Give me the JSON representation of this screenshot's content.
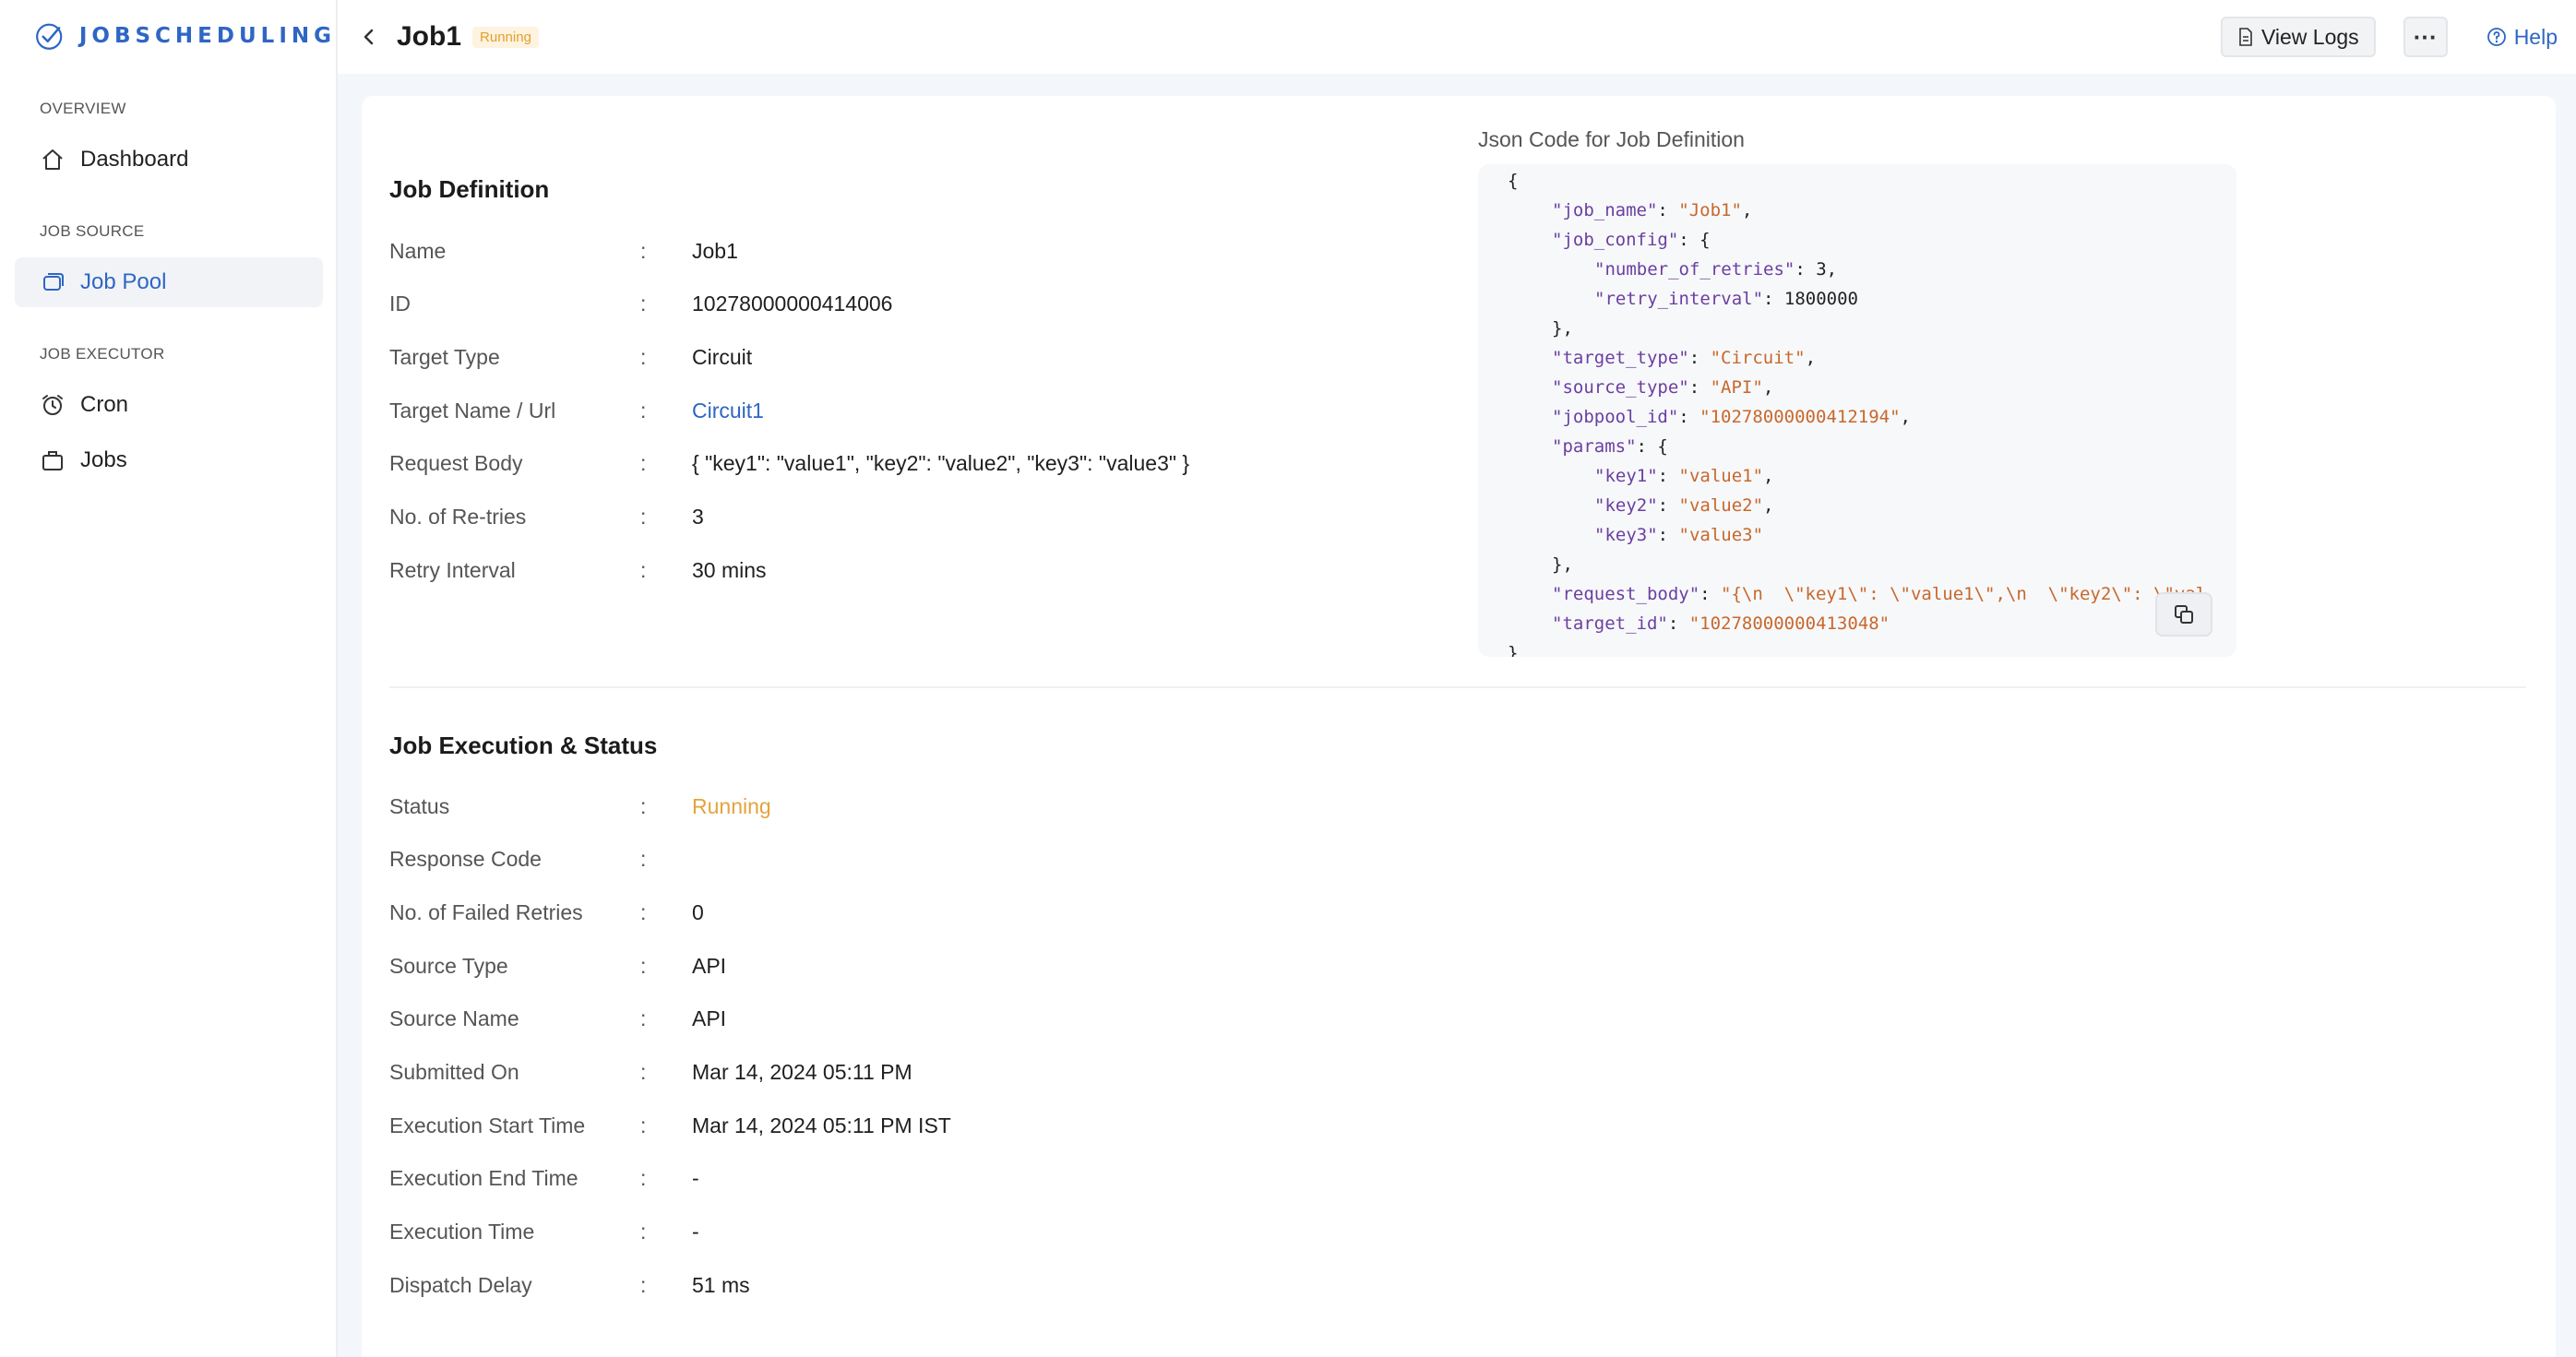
{
  "app": {
    "brand": "JOBSCHEDULING"
  },
  "sidebar": {
    "sections": [
      {
        "label": "OVERVIEW",
        "items": [
          {
            "label": "Dashboard",
            "icon": "home-icon"
          }
        ]
      },
      {
        "label": "JOB SOURCE",
        "items": [
          {
            "label": "Job Pool",
            "icon": "layers-icon",
            "active": true
          }
        ]
      },
      {
        "label": "JOB EXECUTOR",
        "items": [
          {
            "label": "Cron",
            "icon": "alarm-clock-icon"
          },
          {
            "label": "Jobs",
            "icon": "briefcase-icon"
          }
        ]
      }
    ]
  },
  "header": {
    "title": "Job1",
    "status": "Running",
    "view_logs_label": "View Logs",
    "more_label": "···",
    "help_label": "Help"
  },
  "definition": {
    "title": "Job Definition",
    "rows": [
      {
        "label": "Name",
        "value": "Job1"
      },
      {
        "label": "ID",
        "value": "10278000000414006"
      },
      {
        "label": "Target Type",
        "value": "Circuit"
      },
      {
        "label": "Target Name / Url",
        "value": "Circuit1"
      },
      {
        "label": "Request Body",
        "value": "{ \"key1\": \"value1\", \"key2\": \"value2\", \"key3\": \"value3\" }"
      },
      {
        "label": "No. of Re-tries",
        "value": "3"
      },
      {
        "label": "Retry Interval",
        "value": "30 mins"
      }
    ]
  },
  "json_panel": {
    "title": "Json Code for Job Definition",
    "lines": [
      {
        "indent": 0,
        "text": "{"
      },
      {
        "indent": 1,
        "key": "\"job_name\"",
        "sep": ": ",
        "val": "\"Job1\"",
        "tail": ","
      },
      {
        "indent": 1,
        "key": "\"job_config\"",
        "sep": ": {",
        "val": "",
        "tail": ""
      },
      {
        "indent": 2,
        "key": "\"number_of_retries\"",
        "sep": ": 3,",
        "val": "",
        "tail": ""
      },
      {
        "indent": 2,
        "key": "\"retry_interval\"",
        "sep": ": 1800000",
        "val": "",
        "tail": ""
      },
      {
        "indent": 1,
        "text": "},"
      },
      {
        "indent": 1,
        "key": "\"target_type\"",
        "sep": ": ",
        "val": "\"Circuit\"",
        "tail": ","
      },
      {
        "indent": 1,
        "key": "\"source_type\"",
        "sep": ": ",
        "val": "\"API\"",
        "tail": ","
      },
      {
        "indent": 1,
        "key": "\"jobpool_id\"",
        "sep": ": ",
        "val": "\"10278000000412194\"",
        "tail": ","
      },
      {
        "indent": 1,
        "key": "\"params\"",
        "sep": ": {",
        "val": "",
        "tail": ""
      },
      {
        "indent": 2,
        "key": "\"key1\"",
        "sep": ": ",
        "val": "\"value1\"",
        "tail": ","
      },
      {
        "indent": 2,
        "key": "\"key2\"",
        "sep": ": ",
        "val": "\"value2\"",
        "tail": ","
      },
      {
        "indent": 2,
        "key": "\"key3\"",
        "sep": ": ",
        "val": "\"value3\"",
        "tail": ""
      },
      {
        "indent": 1,
        "text": "},"
      },
      {
        "indent": 1,
        "key": "\"request_body\"",
        "sep": ": ",
        "val": "\"{\\n  \\\"key1\\\": \\\"value1\\\",\\n  \\\"key2\\\": \\\"val",
        "tail": ""
      },
      {
        "indent": 1,
        "key": "\"target_id\"",
        "sep": ": ",
        "val": "\"10278000000413048\"",
        "tail": ""
      },
      {
        "indent": 0,
        "text": "}"
      }
    ]
  },
  "execution": {
    "title": "Job Execution & Status",
    "rows": [
      {
        "label": "Status",
        "value": "Running"
      },
      {
        "label": "Response Code",
        "value": ""
      },
      {
        "label": "No. of Failed Retries",
        "value": "0"
      },
      {
        "label": "Source Type",
        "value": "API"
      },
      {
        "label": "Source Name",
        "value": "API"
      },
      {
        "label": "Submitted On",
        "value": "Mar 14, 2024 05:11 PM"
      },
      {
        "label": "Execution Start Time",
        "value": "Mar 14, 2024 05:11 PM IST"
      },
      {
        "label": "Execution End Time",
        "value": "-"
      },
      {
        "label": "Execution Time",
        "value": "-"
      },
      {
        "label": "Dispatch Delay",
        "value": "51 ms"
      }
    ]
  },
  "colors": {
    "accent": "#2f66c4",
    "running": "#e3a43c",
    "json_key": "#6b3fa0",
    "json_value": "#c7682c"
  }
}
